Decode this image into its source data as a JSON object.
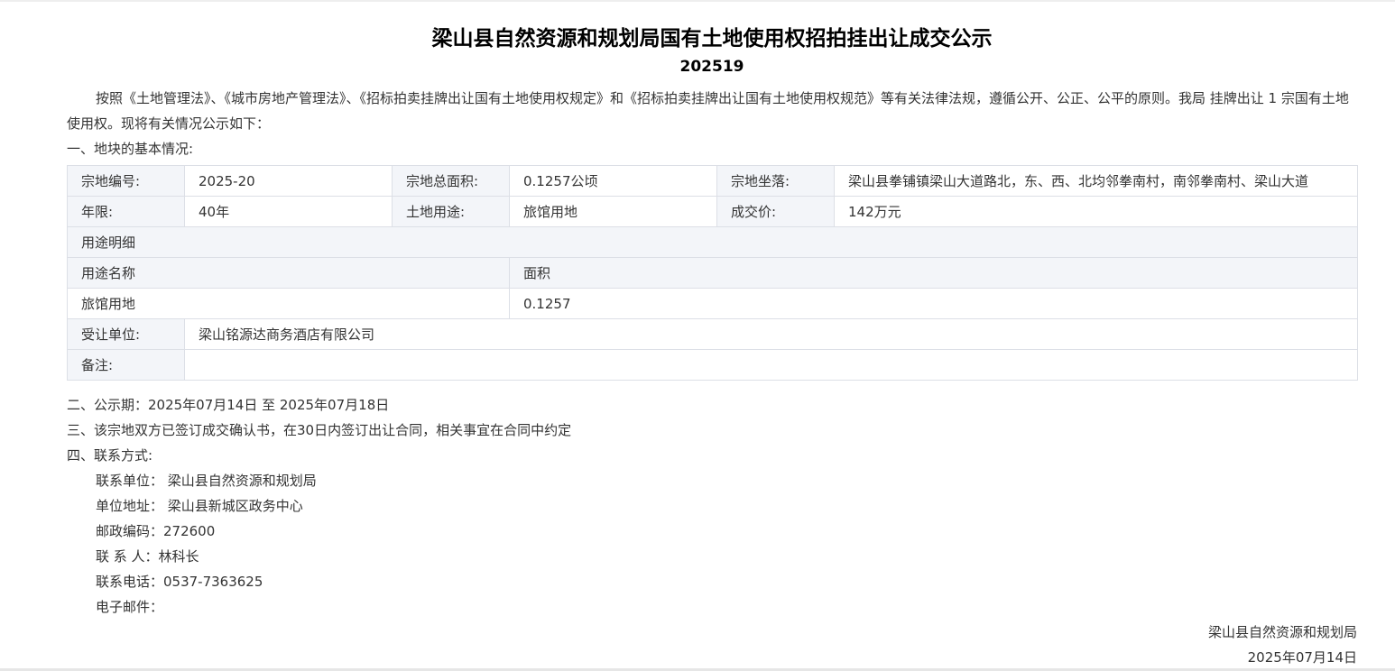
{
  "header": {
    "title": "梁山县自然资源和规划局国有土地使用权招拍挂出让成交公示",
    "number": "202519"
  },
  "intro": "按照《土地管理法》、《城市房地产管理法》、《招标拍卖挂牌出让国有土地使用权规定》和《招标拍卖挂牌出让国有土地使用权规范》等有关法律法规，遵循公开、公正、公平的原则。我局 挂牌出让 1 宗国有土地使用权。现将有关情况公示如下：",
  "section1_title": "一、地块的基本情况:",
  "table": {
    "row1": {
      "label1": "宗地编号:",
      "value1": "2025-20",
      "label2": "宗地总面积:",
      "value2": "0.1257公顷",
      "label3": "宗地坐落:",
      "value3": "梁山县拳铺镇梁山大道路北，东、西、北均邻拳南村，南邻拳南村、梁山大道"
    },
    "row2": {
      "label1": "年限:",
      "value1": "40年",
      "label2": "土地用途:",
      "value2": "旅馆用地",
      "label3": "成交价:",
      "value3": "142万元"
    },
    "usage_header": "用途明细",
    "usage_col1": "用途名称",
    "usage_col2": "面积",
    "usage_name": "旅馆用地",
    "usage_area": "0.1257",
    "assignee_label": "受让单位:",
    "assignee_value": "梁山铭源达商务酒店有限公司",
    "remark_label": "备注:",
    "remark_value": ""
  },
  "section2": "二、公示期：2025年07月14日 至 2025年07月18日",
  "section3": "三、该宗地双方已签订成交确认书，在30日内签订出让合同，相关事宜在合同中约定",
  "section4": "四、联系方式:",
  "contact": {
    "unit": "联系单位：  梁山县自然资源和规划局",
    "address": "单位地址：  梁山县新城区政务中心",
    "postcode": "邮政编码：272600",
    "person": "联 系 人：林科长",
    "phone": "联系电话：0537-7363625",
    "email": "电子邮件："
  },
  "signature": {
    "org": "梁山县自然资源和规划局",
    "date": "2025年07月14日"
  }
}
